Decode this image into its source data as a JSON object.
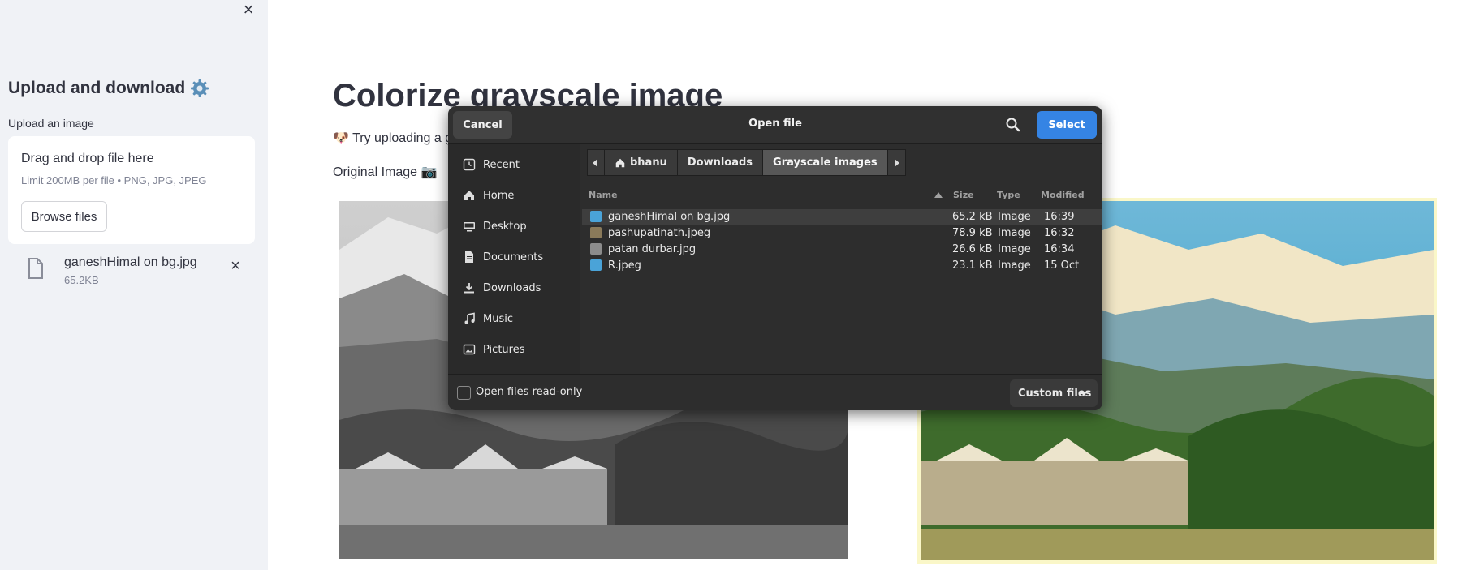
{
  "sidebar": {
    "close_icon": "×",
    "title": "Upload and download",
    "upload_label": "Upload an image",
    "dropzone": {
      "title": "Drag and drop file here",
      "limit": "Limit 200MB per file • PNG, JPG, JPEG",
      "browse_label": "Browse files"
    },
    "uploaded_file": {
      "name": "ganeshHimal on bg.jpg",
      "size": "65.2KB",
      "remove_icon": "×"
    }
  },
  "main": {
    "title": "Colorize grayscale image",
    "subtitle": "🐶 Try uploading a grayscale image, or pick one from the sample directory.",
    "original_label": "Original Image 📷"
  },
  "dialog": {
    "title": "Open file",
    "cancel_label": "Cancel",
    "select_label": "Select",
    "places": [
      {
        "label": "Recent",
        "icon": "recent-icon"
      },
      {
        "label": "Home",
        "icon": "home-icon"
      },
      {
        "label": "Desktop",
        "icon": "desktop-icon"
      },
      {
        "label": "Documents",
        "icon": "documents-icon"
      },
      {
        "label": "Downloads",
        "icon": "downloads-icon"
      },
      {
        "label": "Music",
        "icon": "music-icon"
      },
      {
        "label": "Pictures",
        "icon": "pictures-icon"
      }
    ],
    "path": [
      "bhanu",
      "Downloads",
      "Grayscale images"
    ],
    "columns": {
      "name": "Name",
      "size": "Size",
      "type": "Type",
      "modified": "Modified"
    },
    "files": [
      {
        "name": "ganeshHimal on bg.jpg",
        "size": "65.2 kB",
        "type": "Image",
        "modified": "16:39",
        "selected": true
      },
      {
        "name": "pashupatinath.jpeg",
        "size": "78.9 kB",
        "type": "Image",
        "modified": "16:32",
        "selected": false
      },
      {
        "name": "patan durbar.jpg",
        "size": "26.6 kB",
        "type": "Image",
        "modified": "16:34",
        "selected": false
      },
      {
        "name": "R.jpeg",
        "size": "23.1 kB",
        "type": "Image",
        "modified": "15 Oct",
        "selected": false
      }
    ],
    "readonly_label": "Open files read-only",
    "filter_label": "Custom files"
  },
  "colors": {
    "sidebar_bg": "#f0f2f6",
    "dialog_bg": "#2d2d2d",
    "accent": "#3584e4"
  }
}
